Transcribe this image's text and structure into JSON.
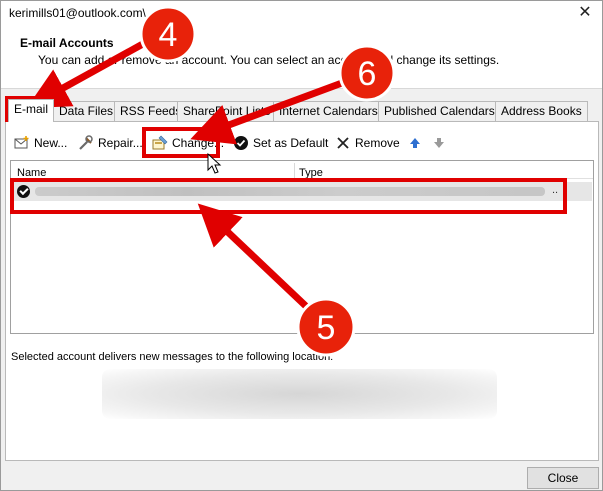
{
  "window": {
    "title": "kerimills01@outlook.com\\",
    "close_glyph": "✕"
  },
  "header": {
    "title": "E-mail Accounts",
    "subtitle": "You can add or remove an account. You can select an account and change its settings."
  },
  "tabs": [
    {
      "label": "E-mail",
      "active": true
    },
    {
      "label": "Data Files"
    },
    {
      "label": "RSS Feeds"
    },
    {
      "label": "SharePoint Lists"
    },
    {
      "label": "Internet Calendars"
    },
    {
      "label": "Published Calendars"
    },
    {
      "label": "Address Books"
    }
  ],
  "toolbar": {
    "new_label": "New...",
    "repair_label": "Repair...",
    "change_label": "Change...",
    "set_default_label": "Set as Default",
    "remove_label": "Remove"
  },
  "list": {
    "col_name": "Name",
    "col_type": "Type",
    "row_trailing": ".."
  },
  "deliver_label": "Selected account delivers new messages to the following location:",
  "close_button": "Close",
  "annotations": {
    "step_4": "4",
    "step_5": "5",
    "step_6": "6",
    "color": "#e00000"
  }
}
